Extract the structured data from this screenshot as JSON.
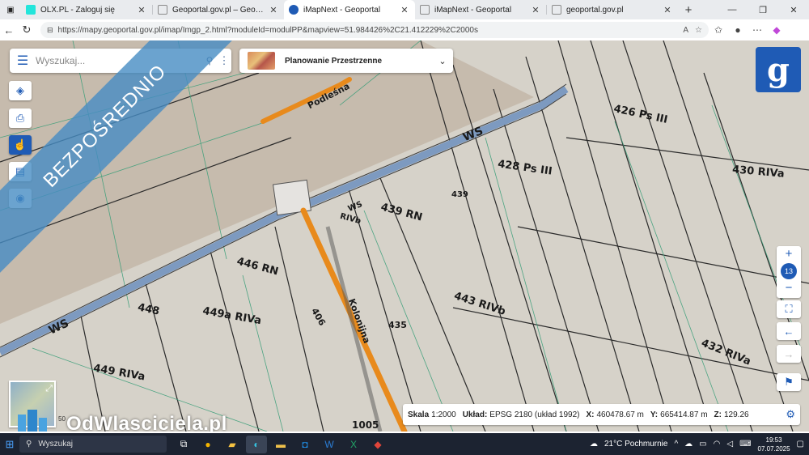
{
  "browser": {
    "tabs": [
      {
        "title": "OLX.PL - Zaloguj się",
        "favicon_color": "#23e5db",
        "active": false
      },
      {
        "title": "Geoportal.gov.pl – Geoportal Infr",
        "favicon_color": "#8a8a8a",
        "active": false
      },
      {
        "title": "iMapNext - Geoportal",
        "favicon_color": "#1f5bb5",
        "active": true
      },
      {
        "title": "iMapNext - Geoportal",
        "favicon_color": "#8a8a8a",
        "active": false
      },
      {
        "title": "geoportal.gov.pl",
        "favicon_color": "#8a8a8a",
        "active": false
      }
    ],
    "url": "https://mapy.geoportal.gov.pl/imap/Imgp_2.html?moduleId=modulPP&mapview=51.984426%2C21.412229%2C2000s"
  },
  "map_ui": {
    "search_placeholder": "Wyszukaj...",
    "layer_name": "Planowanie Przestrzenne",
    "zoom_level": "13",
    "status": {
      "scale_label": "Skala",
      "scale_value": "1:2000",
      "crs_label": "Układ:",
      "crs_value": "EPSG 2180 (układ 1992)",
      "x_label": "X:",
      "x_value": "460478.67 m",
      "y_label": "Y:",
      "y_value": "665414.87 m",
      "z_label": "Z:",
      "z_value": "129.26"
    },
    "scalebar_text": "50",
    "logo_letter": "g"
  },
  "map_labels": {
    "road1": "Podleśna",
    "road2": "Kolonijna",
    "ws1": "WS",
    "ws2": "WS",
    "ws3": "WS",
    "p1": "446 RN",
    "p2": "449a RIVa",
    "p3": "449 RIVa",
    "p4": "448",
    "p5": "430 RIVa",
    "p6": "428 Ps III",
    "p7": "426 Ps III",
    "p8": "439 RN",
    "p9": "443 RIVb",
    "p10": "432 RIVa",
    "p11": "435",
    "p12": "406",
    "p13": "439",
    "p14": "RIVb",
    "p15": "1005"
  },
  "overlay": {
    "banner": "BEZPOŚREDNIO",
    "watermark": "OdWlasciciela.pl"
  },
  "taskbar": {
    "search": "Wyszukaj",
    "weather": "21°C Pochmurnie",
    "time": "19:53",
    "date": "07.07.2025"
  }
}
